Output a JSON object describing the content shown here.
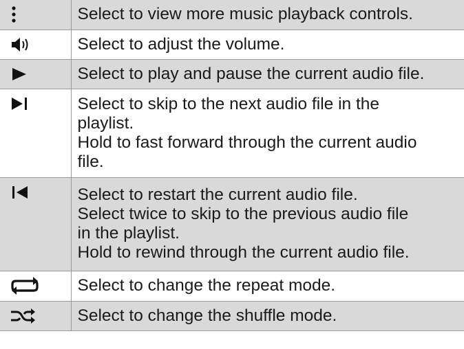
{
  "rows": [
    {
      "icon": "more-vertical-icon",
      "lines": [
        "Select to view more music playback controls."
      ]
    },
    {
      "icon": "volume-icon",
      "lines": [
        "Select to adjust the volume."
      ]
    },
    {
      "icon": "play-icon",
      "lines": [
        "Select to play and pause the current audio file."
      ]
    },
    {
      "icon": "skip-next-icon",
      "lines": [
        "Select to skip to the next audio file in the",
        "playlist.",
        "Hold to fast forward through the current audio",
        "file."
      ]
    },
    {
      "icon": "skip-previous-icon",
      "lines": [
        "Select to restart the current audio file.",
        "Select twice to skip to the previous audio file",
        "in the playlist.",
        "Hold to rewind through the current audio file."
      ]
    },
    {
      "icon": "repeat-icon",
      "lines": [
        "Select to change the repeat mode."
      ]
    },
    {
      "icon": "shuffle-icon",
      "lines": [
        "Select to change the shuffle mode."
      ]
    }
  ]
}
